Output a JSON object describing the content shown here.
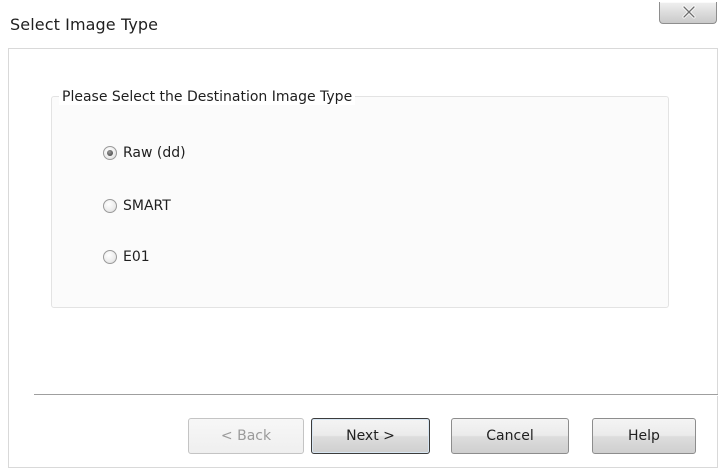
{
  "window": {
    "title": "Select Image Type",
    "close_glyph": "X"
  },
  "group": {
    "legend": "Please Select the Destination Image Type"
  },
  "options": [
    {
      "label": "Raw (dd)",
      "selected": true
    },
    {
      "label": "SMART",
      "selected": false
    },
    {
      "label": "E01",
      "selected": false
    }
  ],
  "buttons": {
    "back": "< Back",
    "next": "Next >",
    "cancel": "Cancel",
    "help": "Help"
  },
  "icons": {
    "close": "close-icon"
  }
}
